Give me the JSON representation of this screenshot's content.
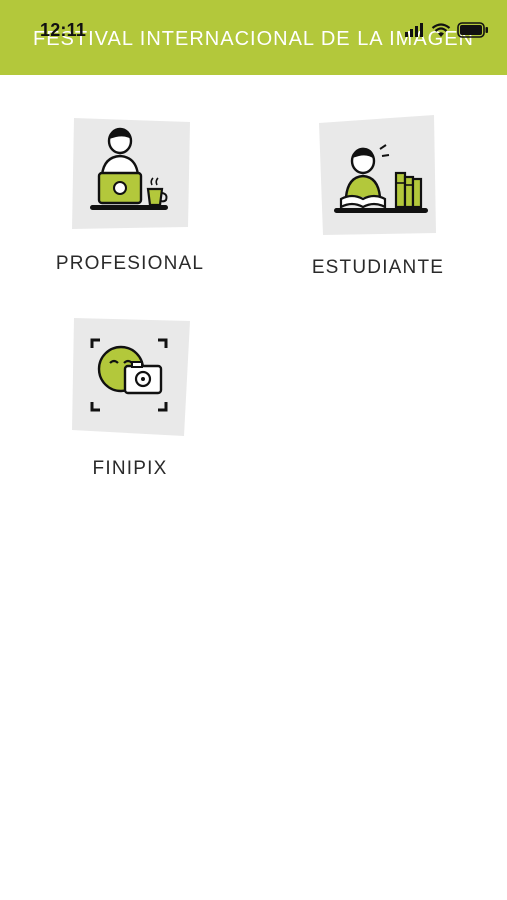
{
  "status_bar": {
    "time": "12:11"
  },
  "header": {
    "title": "FESTIVAL INTERNACIONAL DE LA IMAGEN"
  },
  "menu": {
    "items": [
      {
        "label": "PROFESIONAL",
        "icon": "professional-laptop-icon"
      },
      {
        "label": "ESTUDIANTE",
        "icon": "student-reading-icon"
      },
      {
        "label": "FINIPIX",
        "icon": "smiley-camera-icon"
      }
    ]
  },
  "colors": {
    "accent": "#b3c83b",
    "tile_bg": "#e9e9e9",
    "text": "#2a2a2a"
  }
}
